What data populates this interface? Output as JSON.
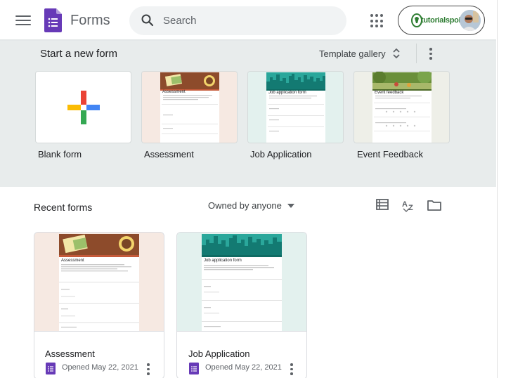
{
  "header": {
    "menu_icon": "hamburger-menu-icon",
    "app_name": "Forms",
    "search_placeholder": "Search",
    "apps_icon": "google-apps-grid-icon",
    "account_brand": "tutorialspoint"
  },
  "templates": {
    "heading": "Start a new form",
    "gallery_label": "Template gallery",
    "items": [
      {
        "label": "Blank form"
      },
      {
        "label": "Assessment",
        "preview_title": "Assessment"
      },
      {
        "label": "Job Application",
        "preview_title": "Job application form"
      },
      {
        "label": "Event Feedback",
        "preview_title": "Event feedback"
      }
    ]
  },
  "recent": {
    "heading": "Recent forms",
    "owner_filter": "Owned by anyone",
    "cards": [
      {
        "name": "Assessment",
        "opened": "Opened May 22, 2021",
        "preview_title": "Assessment"
      },
      {
        "name": "Job Application",
        "opened": "Opened May 22, 2021",
        "preview_title": "Job application form"
      }
    ]
  },
  "colors": {
    "forms_purple": "#673ab7",
    "template_bg": "#e8ecec",
    "plus_blue": "#4285f4",
    "plus_red": "#ea4335",
    "plus_yellow": "#fbbc04",
    "plus_green": "#34a853"
  }
}
